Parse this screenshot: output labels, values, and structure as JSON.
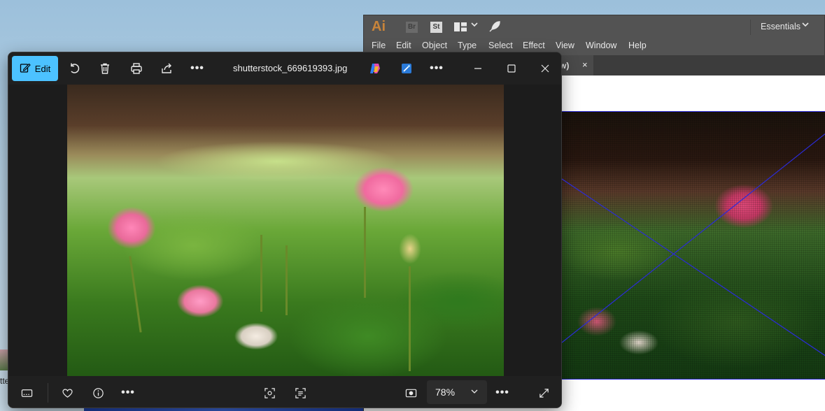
{
  "desktop": {
    "icon_label": "tte"
  },
  "illustrator": {
    "logo": "Ai",
    "bridge_label": "Br",
    "stock_label": "St",
    "workspace": "Essentials",
    "menu": [
      "File",
      "Edit",
      "Object",
      "Type",
      "Select",
      "Effect",
      "View",
      "Window",
      "Help"
    ],
    "tab_label": "w)",
    "tab_close": "×"
  },
  "photos": {
    "toolbar": {
      "edit_label": "Edit"
    },
    "file_name": "shutterstock_669619393.jpg",
    "more_glyph": "•••",
    "zoom": "78%"
  },
  "colors": {
    "accent": "#4cc2ff",
    "photos_bg": "#1c1c1c",
    "ai_chrome": "#535353",
    "ai_logo": "#c8843a",
    "selection_line": "#2b2bd8"
  },
  "icons": {
    "photos_toolbar": [
      "edit-icon",
      "rotate-icon",
      "trash-icon",
      "print-icon",
      "share-icon",
      "more-icon",
      "copilot-icon",
      "designer-icon",
      "more-icon"
    ],
    "photos_bottombar": [
      "filmstrip-icon",
      "heart-icon",
      "info-icon",
      "more-icon",
      "focus-icon",
      "scan-icon",
      "aspect-icon",
      "chevron-down-icon",
      "more-icon",
      "expand-icon"
    ]
  }
}
